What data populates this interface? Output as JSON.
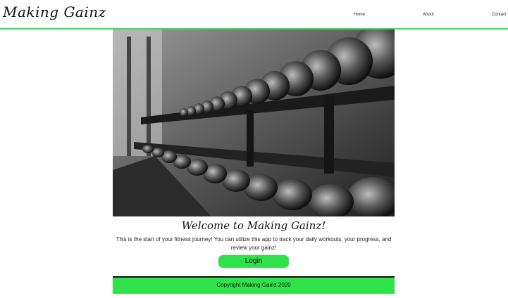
{
  "header": {
    "brand": "Making Gainz",
    "nav": [
      "Home",
      "About",
      "Contact"
    ]
  },
  "hero": {
    "image_alt": "gym-dumbbell-rack-photo"
  },
  "main": {
    "welcome": "Welcome to Making Gainz!",
    "intro": "This is the start of your fitness journey! You can utilize this app to track your daily workouts, your progress, and review your gainz!",
    "login_label": "Login"
  },
  "footer": {
    "copyright": "Copyright Making Gainz 2020"
  },
  "colors": {
    "accent": "#2fe24a",
    "header_border": "#3ddc5a"
  }
}
